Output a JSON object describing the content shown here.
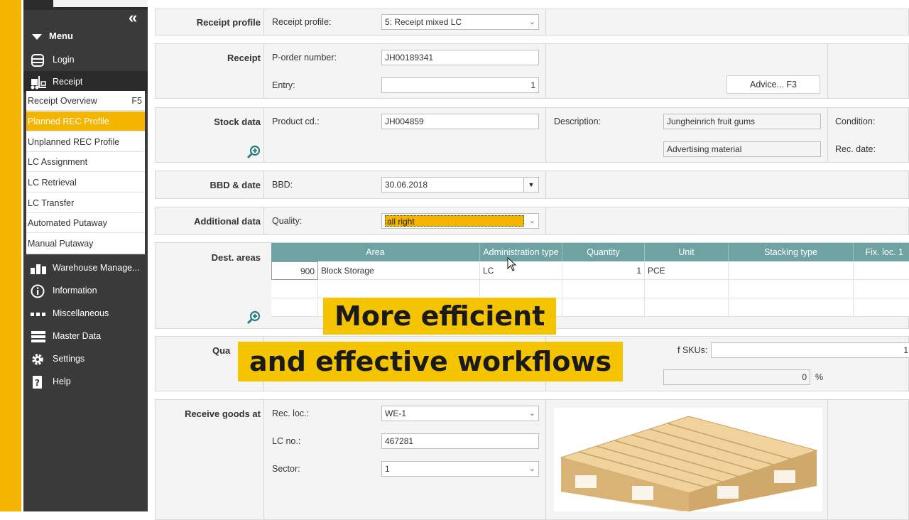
{
  "sidebar": {
    "collapse_glyph": "«",
    "menu_label": "Menu",
    "items": [
      {
        "label": "Login",
        "icon": "login-icon"
      },
      {
        "label": "Receipt",
        "icon": "forklift-icon"
      },
      {
        "label": "Warehouse Manage...",
        "icon": "warehouse-icon"
      },
      {
        "label": "Information",
        "icon": "info-icon"
      },
      {
        "label": "Miscellaneous",
        "icon": "dots-icon"
      },
      {
        "label": "Master Data",
        "icon": "database-icon"
      },
      {
        "label": "Settings",
        "icon": "gear-icon"
      },
      {
        "label": "Help",
        "icon": "help-icon"
      }
    ],
    "subitems": [
      {
        "label": "Receipt Overview",
        "key": "F5"
      },
      {
        "label": "Planned REC Profile",
        "key": ""
      },
      {
        "label": "Unplanned REC Profile",
        "key": ""
      },
      {
        "label": "LC Assignment",
        "key": ""
      },
      {
        "label": "LC Retrieval",
        "key": ""
      },
      {
        "label": "LC Transfer",
        "key": ""
      },
      {
        "label": "Automated Putaway",
        "key": ""
      },
      {
        "label": "Manual Putaway",
        "key": ""
      }
    ]
  },
  "receipt_profile": {
    "title": "Receipt profile",
    "label": "Receipt profile:",
    "value": "5:   Receipt mixed LC"
  },
  "receipt": {
    "title": "Receipt",
    "porder_label": "P-order number:",
    "porder_value": "JH00189341",
    "entry_label": "Entry:",
    "entry_value": "1",
    "advice_button": "Advice... F3"
  },
  "stock": {
    "title": "Stock data",
    "product_label": "Product cd.:",
    "product_value": "JH004859",
    "description_label": "Description:",
    "description_1": "Jungheinrich fruit gums",
    "description_2": "Advertising material",
    "condition_label": "Condition:",
    "recdate_label": "Rec. date:"
  },
  "bbd": {
    "title": "BBD & date",
    "label": "BBD:",
    "value": "30.06.2018"
  },
  "additional": {
    "title": "Additional data",
    "quality_label": "Quality:",
    "quality_value": "all right"
  },
  "dest": {
    "title": "Dest. areas",
    "columns": [
      "Area",
      "Administration type",
      "Quantity",
      "Unit",
      "Stacking type",
      "Fix. loc. 1"
    ],
    "rows": [
      {
        "area_no": "900",
        "area_name": "Block Storage",
        "admin": "LC",
        "qty": "1",
        "unit": "PCE",
        "stacking": "",
        "fix": ""
      }
    ]
  },
  "quantity_section": {
    "title_fragment": "Qua",
    "skus_label_fragment": "f SKUs:",
    "skus_value_fragment": "1",
    "percent_value": "0",
    "percent_unit": "%"
  },
  "receive": {
    "title": "Receive goods at",
    "recloc_label": "Rec. loc.:",
    "recloc_value": "WE-1",
    "lcno_label": "LC no.:",
    "lcno_value": "467281",
    "sector_label": "Sector:",
    "sector_value": "1"
  },
  "overlay": {
    "line1": "More efficient",
    "line2": "and effective workflows"
  },
  "colors": {
    "accent": "#f5b400",
    "sidebar": "#3a3a3a",
    "table_header": "#6fa3a3"
  }
}
